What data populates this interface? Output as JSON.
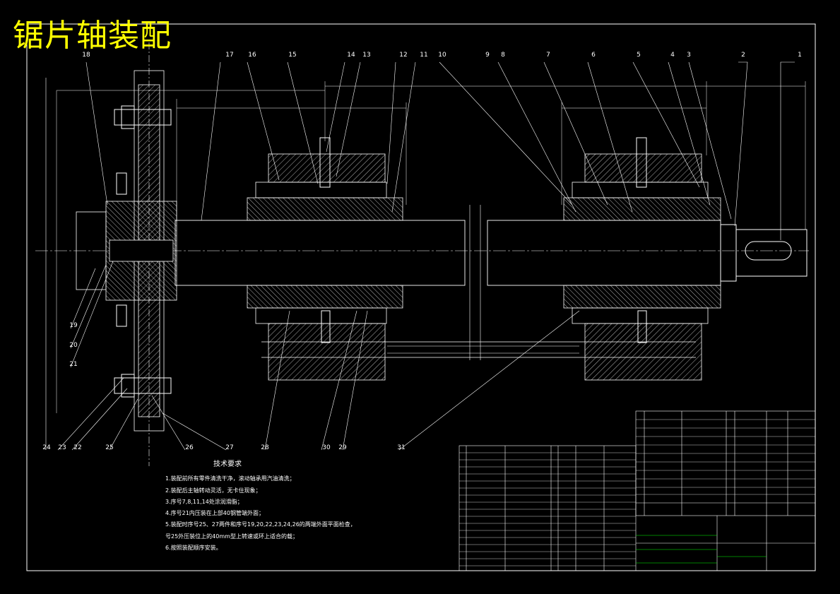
{
  "title": "锯片轴装配",
  "tech_requirements": {
    "heading": "技术要求",
    "items": [
      "1.装配前所有零件清洗干净，滚动轴承用汽油清洗；",
      "2.装配后主轴转动灵活，无卡住现象；",
      "3.序号7,8,11,14处涂润滑脂；",
      "4.序号21内压装在上部40钢管端外面；",
      "5.装配时序号25、27两件和序号19,20,22,23,24,26的两端外面平面检查，",
      "号25外压装位上的40mm型上转速或环上适合的载；",
      "6.按照装配顺序安装。"
    ]
  },
  "balloons": [
    "1",
    "2",
    "3",
    "4",
    "5",
    "6",
    "7",
    "8",
    "9",
    "10",
    "11",
    "12",
    "13",
    "14",
    "15",
    "16",
    "17",
    "18",
    "19",
    "20",
    "21",
    "22",
    "23",
    "24",
    "25",
    "26",
    "27",
    "28",
    "29",
    "30",
    "31"
  ],
  "colors": {
    "background": "#000000",
    "lines": "#ffffff",
    "title": "#ffff00",
    "leader": "#ffffff",
    "table_green": "#00ff00"
  }
}
